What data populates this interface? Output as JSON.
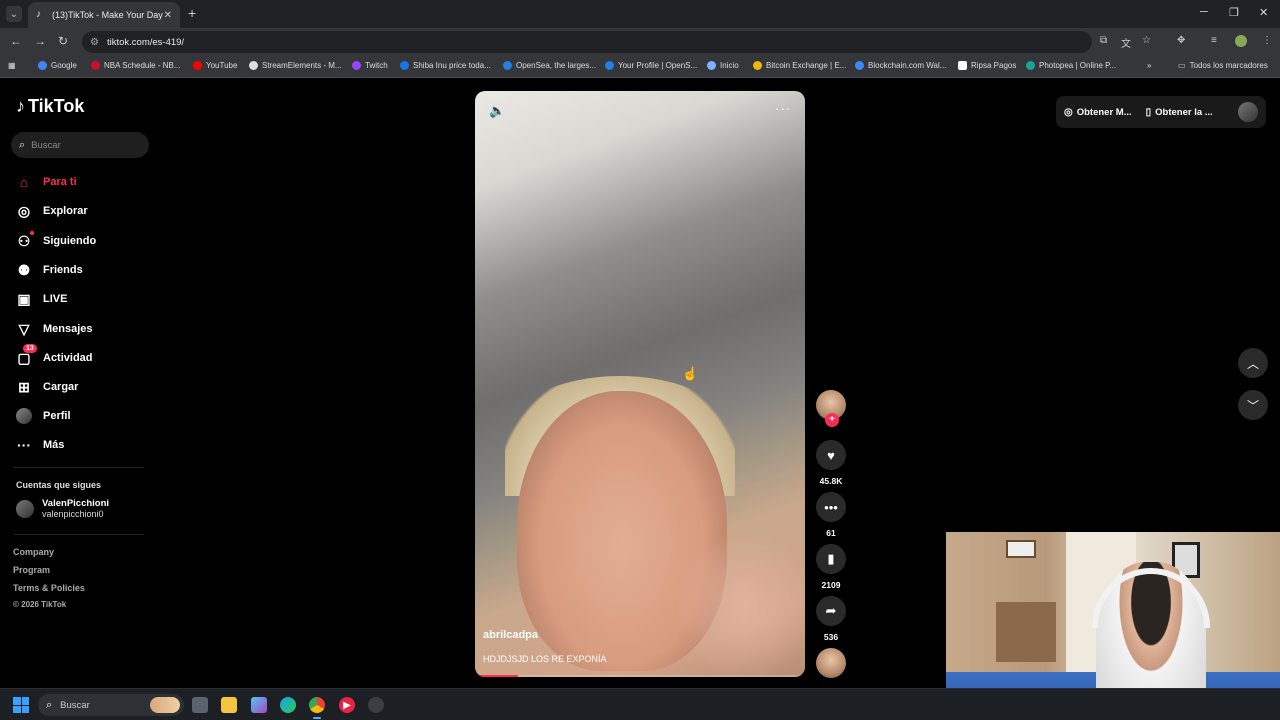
{
  "browser": {
    "tab_title": "(13)TikTok - Make Your Day",
    "url": "tiktok.com/es-419/",
    "bookmarks": [
      {
        "label": "Google",
        "color": "#4285f4"
      },
      {
        "label": "NBA Schedule - NB...",
        "color": "#c8102e"
      },
      {
        "label": "YouTube",
        "color": "#ff0000"
      },
      {
        "label": "StreamElements - M...",
        "color": "#dddddd"
      },
      {
        "label": "Twitch",
        "color": "#9146ff"
      },
      {
        "label": "Shiba Inu price toda...",
        "color": "#1a73e8"
      },
      {
        "label": "OpenSea, the larges...",
        "color": "#2081e2"
      },
      {
        "label": "Your Profile | OpenS...",
        "color": "#2081e2"
      },
      {
        "label": "Inicio",
        "color": "#7fb2ff"
      },
      {
        "label": "Bitcoin Exchange | E...",
        "color": "#f0b90b"
      },
      {
        "label": "Blockchain.com Wal...",
        "color": "#3d89f5"
      },
      {
        "label": "Ripsa Pagos",
        "color": "#ffffff"
      },
      {
        "label": "Photopea | Online P...",
        "color": "#18a497"
      }
    ],
    "all_bookmarks": "Todos los marcadores"
  },
  "tiktok": {
    "logo": "TikTok",
    "search_placeholder": "Buscar",
    "nav": [
      {
        "label": "Para ti",
        "icon": "home-icon"
      },
      {
        "label": "Explorar",
        "icon": "compass-icon"
      },
      {
        "label": "Siguiendo",
        "icon": "following-icon"
      },
      {
        "label": "Friends",
        "icon": "friends-icon"
      },
      {
        "label": "LIVE",
        "icon": "live-icon"
      },
      {
        "label": "Mensajes",
        "icon": "messages-icon"
      },
      {
        "label": "Actividad",
        "icon": "activity-icon",
        "badge": "13"
      },
      {
        "label": "Cargar",
        "icon": "upload-icon"
      },
      {
        "label": "Perfil",
        "icon": "avatar"
      },
      {
        "label": "Más",
        "icon": "more-icon"
      }
    ],
    "following_title": "Cuentas que sigues",
    "following": [
      {
        "name": "ValenPicchioni",
        "handle": "valenpicchioni0"
      }
    ],
    "footer": [
      "Company",
      "Program",
      "Terms & Policies"
    ],
    "copyright": "© 2026 TikTok",
    "top_right": {
      "get_coins": "Obtener M...",
      "get_app": "Obtener la ..."
    },
    "video": {
      "username": "abrilcadpa",
      "description": "HDJDJSJD LOS RE EXPONÍA",
      "progress": 0.13,
      "likes": "45.8K",
      "comments": "61",
      "saves": "2109",
      "shares": "536"
    },
    "accent": "#fe2c55"
  },
  "taskbar": {
    "search_placeholder": "Buscar"
  }
}
